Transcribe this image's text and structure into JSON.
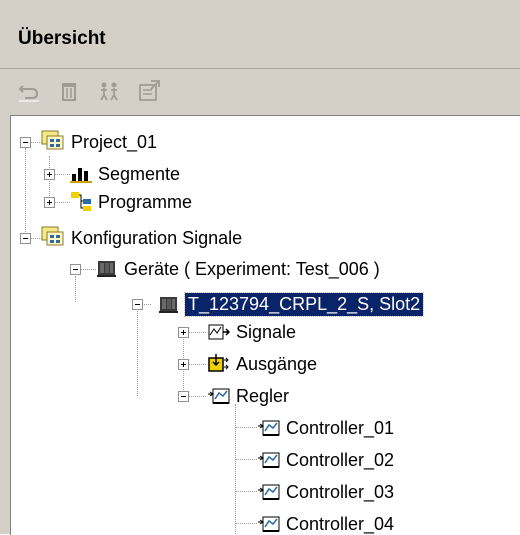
{
  "panel": {
    "title": "Übersicht"
  },
  "toolbar": {
    "buttons": [
      {
        "icon": "undo-icon"
      },
      {
        "icon": "delete-icon"
      },
      {
        "icon": "users-icon"
      },
      {
        "icon": "properties-icon"
      }
    ]
  },
  "tree": {
    "nodes": [
      {
        "label": "Project_01",
        "icon": "project-icon",
        "expanded": true
      },
      {
        "label": "Segmente",
        "icon": "bar-chart-icon",
        "expanded": false
      },
      {
        "label": "Programme",
        "icon": "program-icon",
        "expanded": false
      },
      {
        "label": "Konfiguration Signale",
        "icon": "project-icon",
        "expanded": true
      },
      {
        "label": "Geräte ( Experiment: Test_006 )",
        "icon": "device-icon",
        "expanded": true
      },
      {
        "label": "T_123794_CRPL_2_S, Slot2",
        "icon": "device-icon",
        "expanded": true,
        "selected": true
      },
      {
        "label": "Signale",
        "icon": "signal-icon",
        "expanded": false
      },
      {
        "label": "Ausgänge",
        "icon": "output-icon",
        "expanded": false
      },
      {
        "label": "Regler",
        "icon": "controller-icon",
        "expanded": true
      },
      {
        "label": "Controller_01",
        "icon": "controller-icon"
      },
      {
        "label": "Controller_02",
        "icon": "controller-icon"
      },
      {
        "label": "Controller_03",
        "icon": "controller-icon"
      },
      {
        "label": "Controller_04",
        "icon": "controller-icon"
      }
    ]
  },
  "colors": {
    "selection": "#0a246a",
    "panel": "#d4d0c8"
  }
}
